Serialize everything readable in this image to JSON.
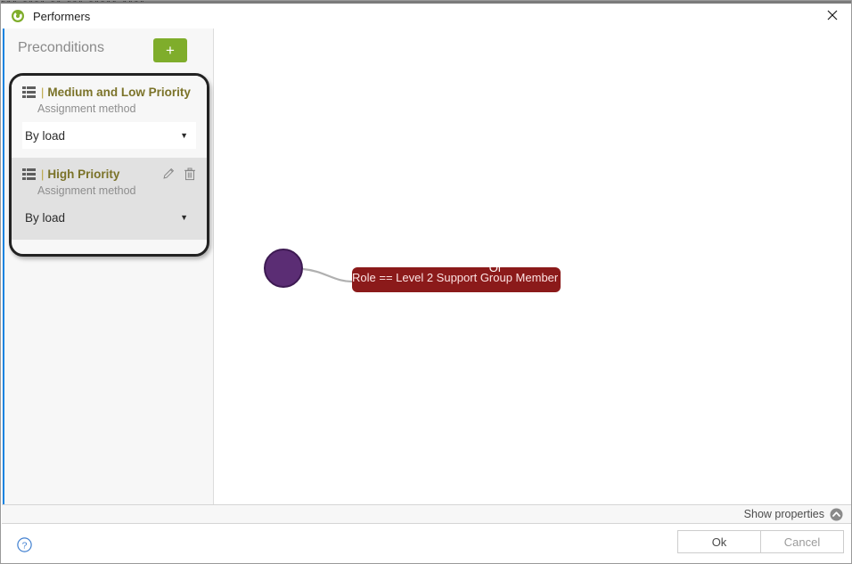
{
  "window": {
    "title": "Performers",
    "app_icon": "performers-circle-icon",
    "close_icon": "close-icon",
    "background_window_text": "‖‖‖ ‖‖‖‖  ‖‖  ‖‖‖  ‖‖‖‖‖  ‖‖‖‖"
  },
  "sidebar": {
    "title": "Preconditions",
    "add_button_label": "+",
    "add_button_color": "#7fad2b",
    "accent_color": "#1a84e0",
    "cards": [
      {
        "grip_icon": "drag-handle-icon",
        "title": "Medium and Low Priority",
        "sublabel": "Assignment method",
        "select_value": "By load",
        "caret_icon": "chevron-down-icon",
        "state": "selected"
      },
      {
        "grip_icon": "drag-handle-icon",
        "title": "High Priority",
        "sublabel": "Assignment method",
        "select_value": "By load",
        "caret_icon": "chevron-down-icon",
        "edit_icon": "pencil-icon",
        "delete_icon": "trash-icon",
        "state": "hovered"
      }
    ]
  },
  "canvas": {
    "operator_node": {
      "label": "Or",
      "fill": "#5b2d74",
      "stroke": "#3d1a52"
    },
    "condition_node": {
      "label": "Role == Level 2 Support Group Member",
      "fill": "#8b1a1a",
      "text_color": "#fde3e3"
    },
    "connector_color": "#b0b0b0"
  },
  "properties_bar": {
    "label": "Show properties",
    "chevron_icon": "chevron-up-icon"
  },
  "footer": {
    "help_icon": "help-circle-icon",
    "ok_label": "Ok",
    "cancel_label": "Cancel"
  }
}
